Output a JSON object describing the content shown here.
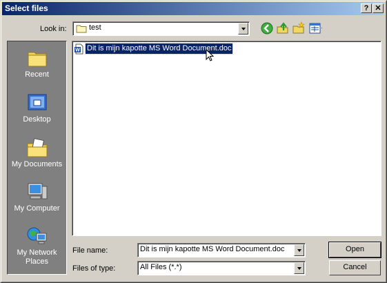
{
  "dialog": {
    "title": "Select files"
  },
  "titlebar_buttons": {
    "help": "?",
    "close": "✕"
  },
  "lookin": {
    "label": "Look in:",
    "value": "test"
  },
  "toolbar": {
    "icons": [
      "back-icon",
      "up-folder-icon",
      "new-folder-icon",
      "views-menu-icon"
    ]
  },
  "places": [
    {
      "label": "Recent",
      "icon": "recent-icon"
    },
    {
      "label": "Desktop",
      "icon": "desktop-icon"
    },
    {
      "label": "My Documents",
      "icon": "my-documents-icon"
    },
    {
      "label": "My Computer",
      "icon": "my-computer-icon"
    },
    {
      "label": "My Network Places",
      "icon": "network-places-icon"
    }
  ],
  "files": [
    {
      "name": "Dit is mijn kapotte MS Word Document.doc",
      "icon": "word-document-icon",
      "selected": true
    }
  ],
  "filename": {
    "label": "File name:",
    "value": "Dit is mijn kapotte MS Word Document.doc"
  },
  "filetype": {
    "label": "Files of type:",
    "value": "All Files (*.*)"
  },
  "buttons": {
    "open": "Open",
    "cancel": "Cancel"
  }
}
